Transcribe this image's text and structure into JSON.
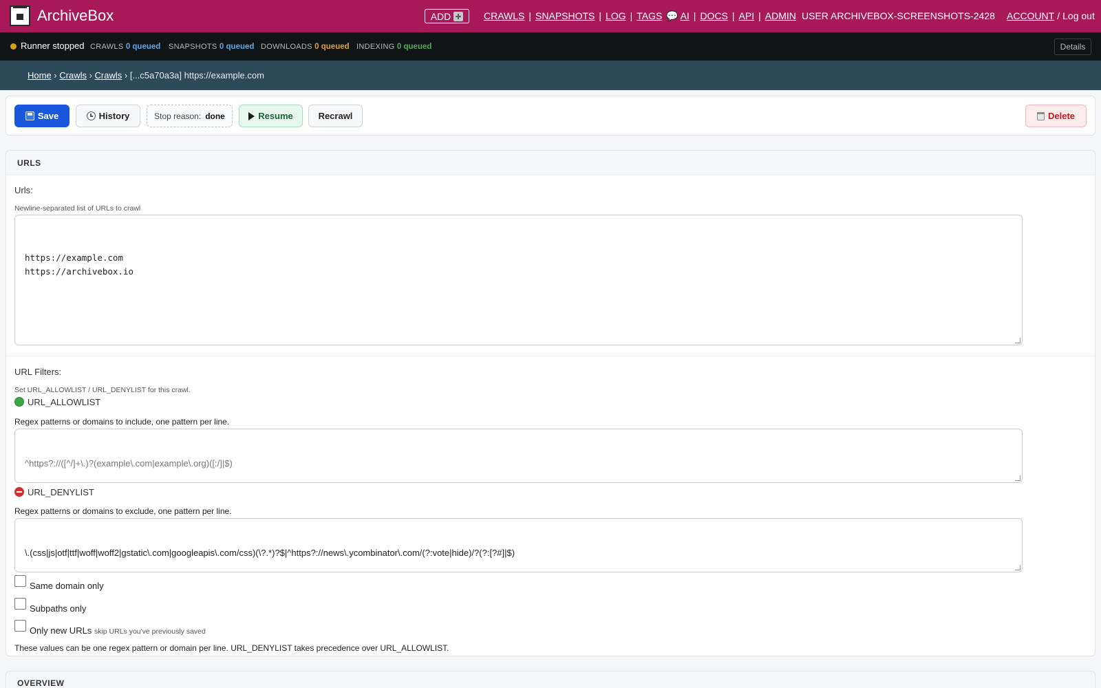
{
  "header": {
    "brand": "ArchiveBox",
    "add_label": "ADD",
    "nav_left": [
      "CRAWLS",
      "SNAPSHOTS",
      "LOG",
      "TAGS"
    ],
    "nav_right_prefix": "💬",
    "nav_right": [
      "AI",
      "DOCS",
      "API",
      "ADMIN"
    ],
    "user": "USER ARCHIVEBOX-SCREENSHOTS-2428",
    "account": "ACCOUNT",
    "logout": "Log out"
  },
  "status": {
    "runner": "Runner stopped",
    "crawls_label": "CRAWLS",
    "crawls_value": "0 queued",
    "snapshots_label": "SNAPSHOTS",
    "snapshots_value": "0 queued",
    "downloads_label": "DOWNLOADS",
    "downloads_value": "0 queued",
    "indexing_label": "INDEXING",
    "indexing_value": "0 queued",
    "details": "Details",
    "colors": {
      "crawls": "#5aa9e6",
      "snapshots": "#5aa9e6",
      "downloads": "#e0a030",
      "indexing": "#4caf50",
      "runner_dot": "#d4a017"
    }
  },
  "breadcrumb": {
    "home": "Home",
    "crawls_1": "Crawls",
    "crawls_2": "Crawls",
    "current": "[...c5a70a3a] https://example.com"
  },
  "toolbar": {
    "save": "Save",
    "history": "History",
    "stop_label": "Stop reason:",
    "stop_value": "done",
    "resume": "Resume",
    "recrawl": "Recrawl",
    "delete": "Delete"
  },
  "urls_panel": {
    "title": "URLS",
    "urls_label": "Urls:",
    "urls_help": "Newline-separated list of URLs to crawl",
    "urls_value": "https://example.com\nhttps://archivebox.io",
    "filters_label": "URL Filters:",
    "filters_help": "Set URL_ALLOWLIST / URL_DENYLIST for this crawl.",
    "allowlist_title": "URL_ALLOWLIST",
    "allowlist_help": "Regex patterns or domains to include, one pattern per line.",
    "allowlist_placeholder": "^https?://([^/]+\\.)?(example\\.com|example\\.org)([:/]|$)",
    "denylist_title": "URL_DENYLIST",
    "denylist_help": "Regex patterns or domains to exclude, one pattern per line.",
    "denylist_value": "\\.(css|js|otf|ttf|woff|woff2|gstatic\\.com|googleapis\\.com/css)(\\?.*)?$|^https?://news\\.ycombinator\\.com/(?:vote|hide)/?(?:[?#]|$)",
    "same_domain": "Same domain only",
    "subpaths": "Subpaths only",
    "only_new": "Only new URLs",
    "only_new_help": "skip URLs you've previously saved",
    "footer_note": "These values can be one regex pattern or domain per line. URL_DENYLIST takes precedence over URL_ALLOWLIST."
  },
  "overview": {
    "title": "OVERVIEW"
  }
}
